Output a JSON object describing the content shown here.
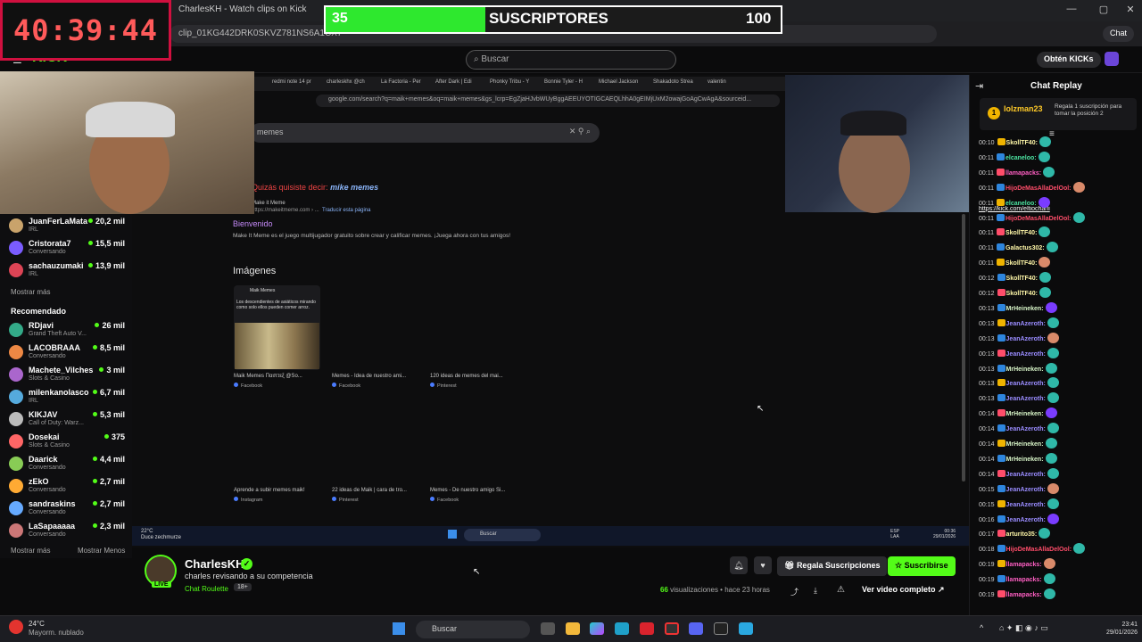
{
  "browser": {
    "tab_title": "CharlesKH - Watch clips on Kick",
    "url": "clip_01KG442DRK0SKVZ781NS6A1CX7",
    "chat_button": "Chat"
  },
  "timer": {
    "value": "40:39:44"
  },
  "subs_goal": {
    "current": "35",
    "label": "SUSCRIPTORES",
    "goal": "100",
    "progress": 0.35
  },
  "topbar": {
    "logo": "KICK",
    "search_placeholder": "Buscar",
    "kicks_button": "Obtén KICKs"
  },
  "sidebar": {
    "following": [
      {
        "name": "JuanFerLaMata",
        "category": "IRL",
        "viewers": "20,2 mil"
      },
      {
        "name": "Cristorata7",
        "category": "Conversando",
        "viewers": "15,5 mil"
      },
      {
        "name": "sachauzumaki",
        "category": "IRL",
        "viewers": "13,9 mil"
      }
    ],
    "show_more": "Mostrar más",
    "recommended_title": "Recomendado",
    "recommended": [
      {
        "name": "RDjavi",
        "category": "Grand Theft Auto V...",
        "viewers": "26 mil"
      },
      {
        "name": "LACOBRAAA",
        "category": "Conversando",
        "viewers": "8,5 mil"
      },
      {
        "name": "Machete_Vilches",
        "category": "Slots & Casino",
        "viewers": "3 mil"
      },
      {
        "name": "milenkanolasco",
        "category": "IRL",
        "viewers": "6,7 mil"
      },
      {
        "name": "KIKJAV",
        "category": "Call of Duty: Warz...",
        "viewers": "5,3 mil"
      },
      {
        "name": "Dosekai",
        "category": "Slots & Casino",
        "viewers": "375"
      },
      {
        "name": "Daarick",
        "category": "Conversando",
        "viewers": "4,4 mil"
      },
      {
        "name": "zEkO",
        "category": "Conversando",
        "viewers": "2,7 mil"
      },
      {
        "name": "sandraskins",
        "category": "Conversando",
        "viewers": "2,7 mil"
      },
      {
        "name": "LaSapaaaaa",
        "category": "Conversando",
        "viewers": "2,3 mil"
      }
    ],
    "show_less": "Mostrar Menos"
  },
  "video": {
    "tabs": [
      "redmi note 14 pr",
      "charleskhx @ch",
      "La Factoria - Per",
      "After Dark | Edi",
      "Phonky Tribu - Y",
      "Bonnie Tyler - H",
      "Michael Jackson",
      "Shakadoto Strea",
      "valentin"
    ],
    "url": "google.com/search?q=maik+memes&oq=maik+memes&gs_lcrp=EgZjaHJvbWUyBggAEEUYOTIGCAEQLhhA0gEIMjUxM2owajGoAgCwAgA&sourceid...",
    "query": "memes",
    "did_you_mean": "Quizás quisiste decir:",
    "suggestion": "mike memes",
    "result_site": "Make it Meme",
    "result_url": "https://makeitmeme.com › ...",
    "translate": "Traducir esta página",
    "result_title": "Bienvenido",
    "result_desc": "Make It Meme es el juego multijugador gratuito sobre crear y calificar memes. ¡Juega ahora con tus amigos!",
    "images_heading": "Imágenes",
    "meme_page": "Maik Memes",
    "meme_text": "Los descendientes de asiáticos mirando como solo ellos pueden comer arroz.",
    "images_row1": [
      {
        "caption": "Maik Memes Παιπτεξ @So...",
        "source": "Facebook"
      },
      {
        "caption": "Memes - Idea de nuestro ami...",
        "source": "Facebook"
      },
      {
        "caption": "120 ideas de memes del mai...",
        "source": "Pinterest"
      }
    ],
    "images_row2": [
      {
        "caption": "Aprende a subir memes maik!",
        "source": "Instagram"
      },
      {
        "caption": "22 ideas de Maik | cara de tro...",
        "source": "Pinterest"
      },
      {
        "caption": "Memes - De nuestro amigo Si...",
        "source": "Facebook"
      }
    ],
    "taskbar_weather": "22°C",
    "taskbar_weather_desc": "Duce zechmurze",
    "taskbar_search": "Buscar",
    "taskbar_lang": "ESP",
    "taskbar_lang2": "LAA",
    "taskbar_time": "00:36",
    "taskbar_date": "29/01/2026"
  },
  "stream": {
    "name": "CharlesKH",
    "title": "charles revisando a su competencia",
    "category": "Chat Roulette",
    "age": "18+",
    "live": "LIVE",
    "gift_button": "Regala Suscripciones",
    "subscribe_button": "Suscribirse",
    "views_count": "66",
    "views_label": "visualizaciones",
    "ago": "hace 23 horas",
    "full_video": "Ver video completo"
  },
  "chat": {
    "title": "Chat Replay",
    "pinned_user": "lolzman23",
    "pinned_count": "1",
    "pinned_msg": "Regala 1 suscripción para tomar la posición 2",
    "messages": [
      {
        "time": "00:10",
        "user": "SkollTF40:",
        "color": "#fff7a8"
      },
      {
        "time": "00:11",
        "user": "elcaneloo:",
        "color": "#4ce3a1"
      },
      {
        "time": "00:11",
        "user": "llamapacks:",
        "color": "#ff5fc3",
        "text": "https://kick.com/eltiocharli"
      },
      {
        "time": "00:11",
        "user": "HijoDeMasAllaDelOol:",
        "color": "#ff4d6a"
      },
      {
        "time": "00:11",
        "user": "elcaneloo:",
        "color": "#4ce3a1"
      },
      {
        "time": "00:11",
        "user": "HijoDeMasAllaDelOol:",
        "color": "#ff4d6a"
      },
      {
        "time": "00:11",
        "user": "SkollTF40:",
        "color": "#fff7a8"
      },
      {
        "time": "00:11",
        "user": "Galactus302:",
        "color": "#fff7a8"
      },
      {
        "time": "00:11",
        "user": "SkollTF40:",
        "color": "#fff7a8"
      },
      {
        "time": "00:12",
        "user": "SkollTF40:",
        "color": "#fff7a8"
      },
      {
        "time": "00:12",
        "user": "SkollTF40:",
        "color": "#fff7a8"
      },
      {
        "time": "00:13",
        "user": "MrHeineken:",
        "color": "#d8f5c8"
      },
      {
        "time": "00:13",
        "user": "JeanAzeroth:",
        "color": "#9a8cff"
      },
      {
        "time": "00:13",
        "user": "JeanAzeroth:",
        "color": "#9a8cff"
      },
      {
        "time": "00:13",
        "user": "JeanAzeroth:",
        "color": "#9a8cff"
      },
      {
        "time": "00:13",
        "user": "MrHeineken:",
        "color": "#d8f5c8"
      },
      {
        "time": "00:13",
        "user": "JeanAzeroth:",
        "color": "#9a8cff"
      },
      {
        "time": "00:13",
        "user": "JeanAzeroth:",
        "color": "#9a8cff"
      },
      {
        "time": "00:14",
        "user": "MrHeineken:",
        "color": "#d8f5c8"
      },
      {
        "time": "00:14",
        "user": "JeanAzeroth:",
        "color": "#9a8cff"
      },
      {
        "time": "00:14",
        "user": "MrHeineken:",
        "color": "#d8f5c8"
      },
      {
        "time": "00:14",
        "user": "MrHeineken:",
        "color": "#d8f5c8"
      },
      {
        "time": "00:14",
        "user": "JeanAzeroth:",
        "color": "#9a8cff"
      },
      {
        "time": "00:15",
        "user": "JeanAzeroth:",
        "color": "#9a8cff"
      },
      {
        "time": "00:15",
        "user": "JeanAzeroth:",
        "color": "#9a8cff"
      },
      {
        "time": "00:16",
        "user": "JeanAzeroth:",
        "color": "#9a8cff"
      },
      {
        "time": "00:17",
        "user": "arturito35:",
        "color": "#fff7a8"
      },
      {
        "time": "00:18",
        "user": "HijoDeMasAllaDelOol:",
        "color": "#ff4d6a"
      },
      {
        "time": "00:19",
        "user": "llamapacks:",
        "color": "#ff5fc3"
      },
      {
        "time": "00:19",
        "user": "llamapacks:",
        "color": "#ff5fc3"
      },
      {
        "time": "00:19",
        "user": "llamapacks:",
        "color": "#ff5fc3"
      }
    ]
  },
  "taskbar": {
    "weather_temp": "24°C",
    "weather_desc": "Mayorm. nublado",
    "search": "Buscar",
    "time": "23:41",
    "date": "29/01/2026"
  },
  "colors": {
    "accent": "#53fc18",
    "timer_border": "#d0103f"
  }
}
